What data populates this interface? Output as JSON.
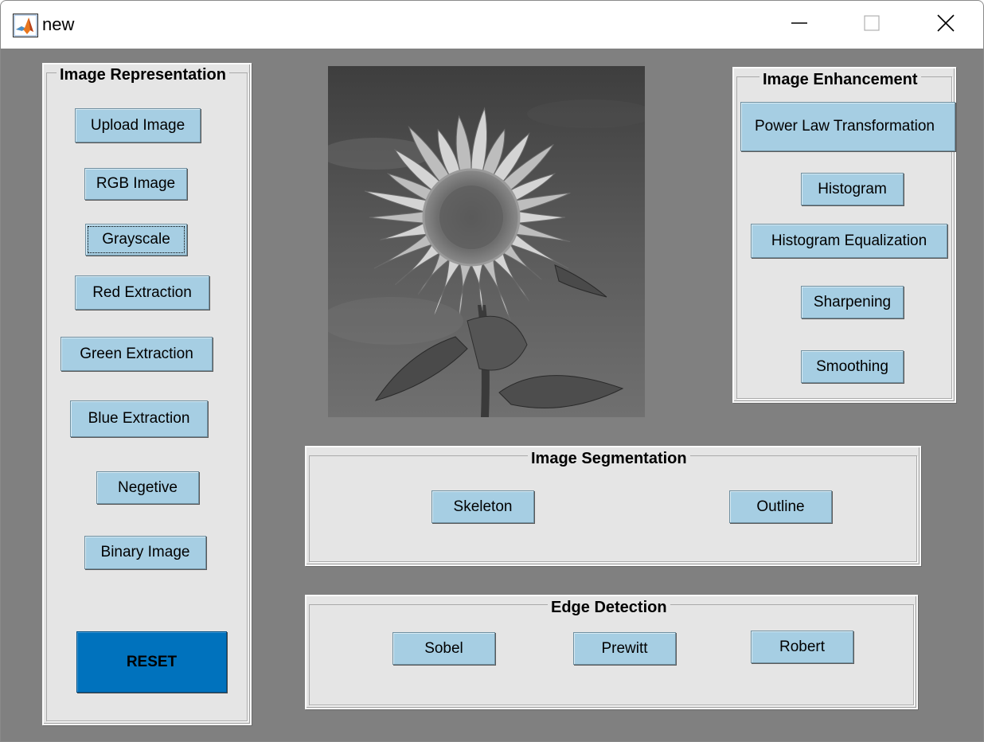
{
  "window": {
    "title": "new"
  },
  "panels": {
    "representation": {
      "title": "Image Representation",
      "buttons": {
        "upload": "Upload Image",
        "rgb": "RGB Image",
        "grayscale": "Grayscale",
        "red": "Red Extraction",
        "green": "Green Extraction",
        "blue": "Blue Extraction",
        "negative": "Negetive",
        "binary": "Binary Image",
        "reset": "RESET"
      }
    },
    "enhancement": {
      "title": "Image Enhancement",
      "buttons": {
        "power_law": "Power Law Transformation",
        "histogram": "Histogram",
        "hist_eq": "Histogram Equalization",
        "sharpening": "Sharpening",
        "smoothing": "Smoothing"
      }
    },
    "segmentation": {
      "title": "Image Segmentation",
      "buttons": {
        "skeleton": "Skeleton",
        "outline": "Outline"
      }
    },
    "edge": {
      "title": "Edge Detection",
      "buttons": {
        "sobel": "Sobel",
        "prewitt": "Prewitt",
        "robert": "Robert"
      }
    }
  },
  "colors": {
    "button_bg": "#a6cee3",
    "reset_bg": "#0072bd",
    "panel_bg": "#e5e5e5",
    "figure_bg": "#808080"
  },
  "icons": {
    "app": "matlab-logo-icon",
    "minimize": "minimize-icon",
    "maximize": "maximize-icon",
    "close": "close-icon"
  }
}
